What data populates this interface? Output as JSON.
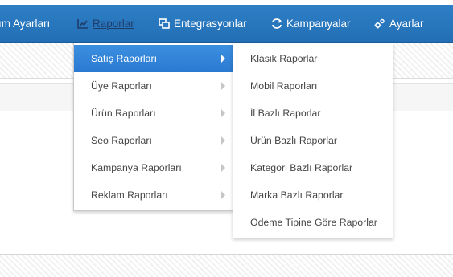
{
  "nav": {
    "items": [
      {
        "label": "ım Ayarları",
        "icon": "none"
      },
      {
        "label": "Raporlar",
        "icon": "chart-icon"
      },
      {
        "label": "Entegrasyonlar",
        "icon": "integration-icon"
      },
      {
        "label": "Kampanyalar",
        "icon": "campaign-icon"
      },
      {
        "label": "Ayarlar",
        "icon": "gear-icon"
      }
    ]
  },
  "reports_menu": {
    "items": [
      {
        "label": "Satış Raporları",
        "active": true
      },
      {
        "label": "Üye Raporları"
      },
      {
        "label": "Ürün Raporları"
      },
      {
        "label": "Seo Raporları"
      },
      {
        "label": "Kampanya Raporları"
      },
      {
        "label": "Reklam Raporları"
      }
    ]
  },
  "sales_submenu": {
    "items": [
      {
        "label": "Klasik Raporlar"
      },
      {
        "label": "Mobil Raporları"
      },
      {
        "label": "İl Bazlı Raporlar"
      },
      {
        "label": "Ürün Bazlı Raporlar"
      },
      {
        "label": "Kategori Bazlı Raporlar"
      },
      {
        "label": "Marka Bazlı Raporlar"
      },
      {
        "label": "Ödeme Tipine Göre Raporlar"
      }
    ]
  },
  "colors": {
    "nav_bg": "#2574bd",
    "active_item_bg": "#3385d8",
    "nav_active_text": "#1f3d6b"
  }
}
